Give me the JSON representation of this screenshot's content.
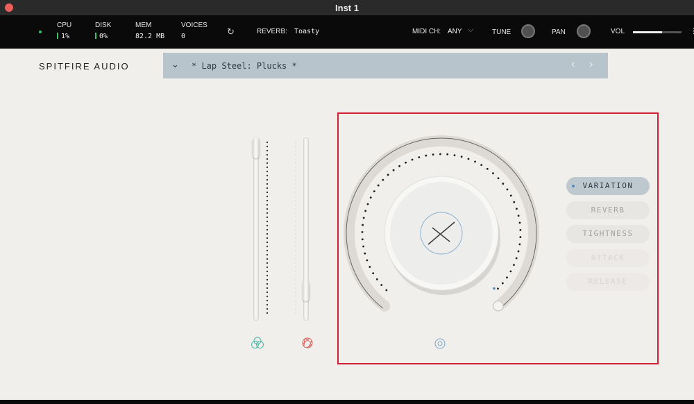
{
  "window": {
    "title": "Inst 1"
  },
  "status": {
    "cpu": {
      "label": "CPU",
      "value": "1%"
    },
    "disk": {
      "label": "DISK",
      "value": "0%"
    },
    "mem": {
      "label": "MEM",
      "value": "82.2 MB"
    },
    "voices": {
      "label": "VOICES",
      "value": "0"
    },
    "reverb": {
      "label": "REVERB:",
      "value": "Toasty"
    },
    "midi": {
      "label": "MIDI CH:",
      "value": "ANY"
    },
    "tune_label": "TUNE",
    "pan_label": "PAN",
    "vol_label": "VOL",
    "vol_level": 0.6
  },
  "brand": "SPITFIRE AUDIO",
  "preset": {
    "name": "* Lap Steel: Plucks *"
  },
  "knob": {
    "value_fraction": 0.78
  },
  "faders": {
    "left_value": 1.0,
    "right_value": 0.12
  },
  "side_buttons": [
    {
      "label": "VARIATION",
      "state": "active"
    },
    {
      "label": "REVERB",
      "state": "idle"
    },
    {
      "label": "TIGHTNESS",
      "state": "idle"
    },
    {
      "label": "ATTACK",
      "state": "faint"
    },
    {
      "label": "RELEASE",
      "state": "faint"
    }
  ],
  "colors": {
    "accent_blue": "#5b89b8",
    "highlight_red": "#d41e35",
    "teal": "#49b9a8",
    "coral": "#d9554f"
  }
}
